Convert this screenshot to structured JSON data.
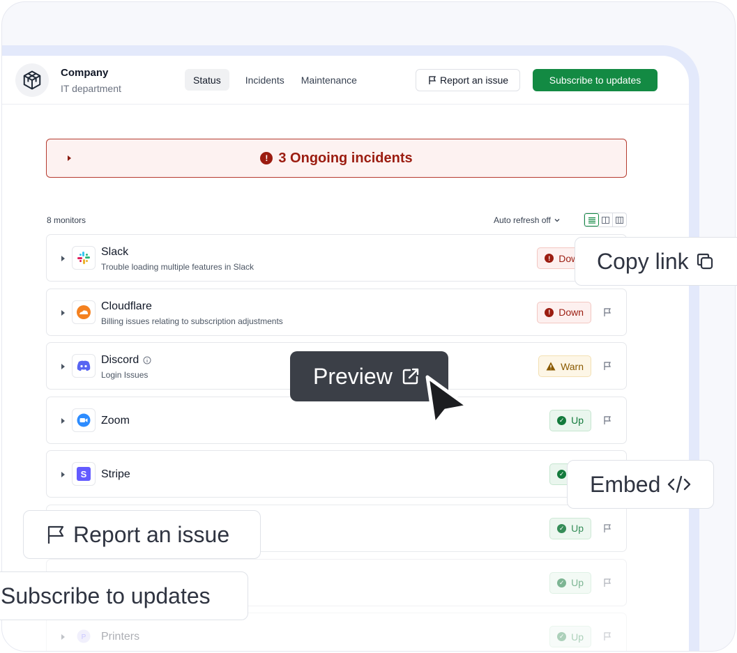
{
  "header": {
    "company": "Company",
    "department": "IT department",
    "nav": [
      "Status",
      "Incidents",
      "Maintenance"
    ],
    "report_button": "Report an issue",
    "subscribe_button": "Subscribe to updates"
  },
  "banner": {
    "text": "3 Ongoing incidents"
  },
  "toolbar": {
    "monitor_count": "8 monitors",
    "auto_refresh": "Auto refresh off"
  },
  "monitors": [
    {
      "name": "Slack",
      "desc": "Trouble loading multiple features in Slack",
      "status": "Down"
    },
    {
      "name": "Cloudflare",
      "desc": "Billing issues relating to subscription adjustments",
      "status": "Down"
    },
    {
      "name": "Discord",
      "desc": "Login Issues",
      "status": "Warn"
    },
    {
      "name": "Zoom",
      "desc": "",
      "status": "Up"
    },
    {
      "name": "Stripe",
      "desc": "",
      "status": "Up"
    },
    {
      "name": "",
      "desc": "",
      "status": "Up"
    },
    {
      "name": "",
      "desc": "",
      "status": "Up"
    },
    {
      "name": "Printers",
      "desc": "",
      "status": "Up",
      "icon_letter": "P"
    }
  ],
  "callouts": {
    "copy_link": "Copy link",
    "preview": "Preview",
    "embed": "Embed",
    "report": "Report an issue",
    "subscribe": "Subscribe to updates"
  },
  "icons": {
    "logo": "cube-logo-icon",
    "slack": "slack-icon",
    "cloudflare": "cloudflare-icon",
    "discord": "discord-icon",
    "zoom": "zoom-icon",
    "stripe": "stripe-icon"
  },
  "colors": {
    "brand_green": "#138a43",
    "down_red": "#9b1c10",
    "warn_amber": "#8a5a00",
    "up_green": "#137a3c"
  }
}
